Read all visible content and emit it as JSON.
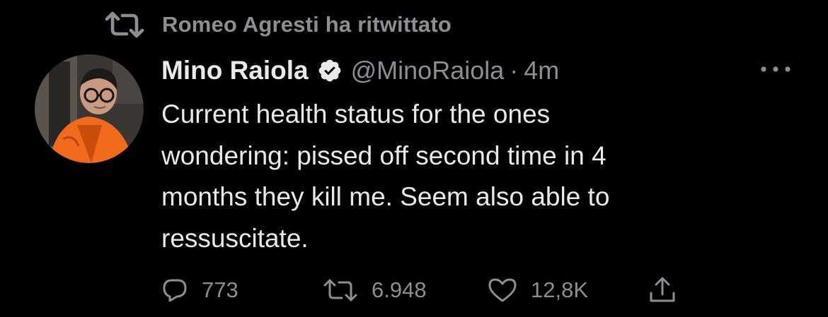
{
  "retweet_context": {
    "label": "Romeo Agresti ha ritwittato",
    "icon": "retweet-icon"
  },
  "author": {
    "name": "Mino Raiola",
    "handle": "@MinoRaiola",
    "separator": "·",
    "time": "4m",
    "verified": true,
    "avatar": "profile-photo"
  },
  "tweet": {
    "text": "Current health status for the ones\nwondering: pissed off second time in 4\nmonths they kill me. Seem also able to\nressuscitate."
  },
  "actions": {
    "reply_count": "773",
    "retweet_count": "6.948",
    "like_count": "12,8K",
    "icons": [
      "reply-icon",
      "retweet-icon",
      "like-icon",
      "share-icon"
    ]
  },
  "colors": {
    "background": "#000000",
    "primary_text": "#e7e9ea",
    "secondary_text": "#8b8f94",
    "avatar_jacket": "#f26a1b"
  }
}
